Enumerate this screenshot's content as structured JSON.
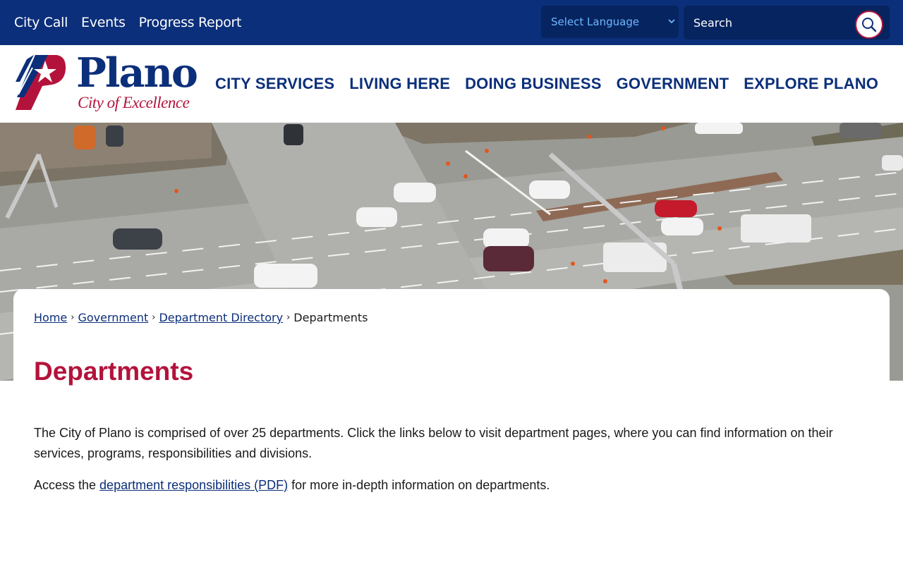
{
  "topbar": {
    "links": [
      "City Call",
      "Events",
      "Progress Report"
    ],
    "language_select": "Select Language",
    "search_placeholder": "Search"
  },
  "logo": {
    "wordmark": "Plano",
    "tagline": "City of Excellence"
  },
  "main_nav": [
    "CITY SERVICES",
    "LIVING HERE",
    "DOING BUSINESS",
    "GOVERNMENT",
    "EXPLORE PLANO"
  ],
  "breadcrumb": {
    "items": [
      "Home",
      "Government",
      "Department Directory"
    ],
    "current": "Departments",
    "separator": "›"
  },
  "page": {
    "title": "Departments",
    "intro": "The City of Plano is comprised of over 25 departments. Click the links below to visit department pages, where you can find information on their services, programs, responsibilities and divisions.",
    "access_prefix": "Access the ",
    "access_link": "department responsibilities (PDF)",
    "access_suffix": " for more in-depth information on departments."
  },
  "colors": {
    "navy": "#0b2f7a",
    "red": "#b3133b",
    "lang_text": "#6fb7ff"
  },
  "icons": [
    "search-icon",
    "chevron-down-icon",
    "star-logo-icon"
  ]
}
